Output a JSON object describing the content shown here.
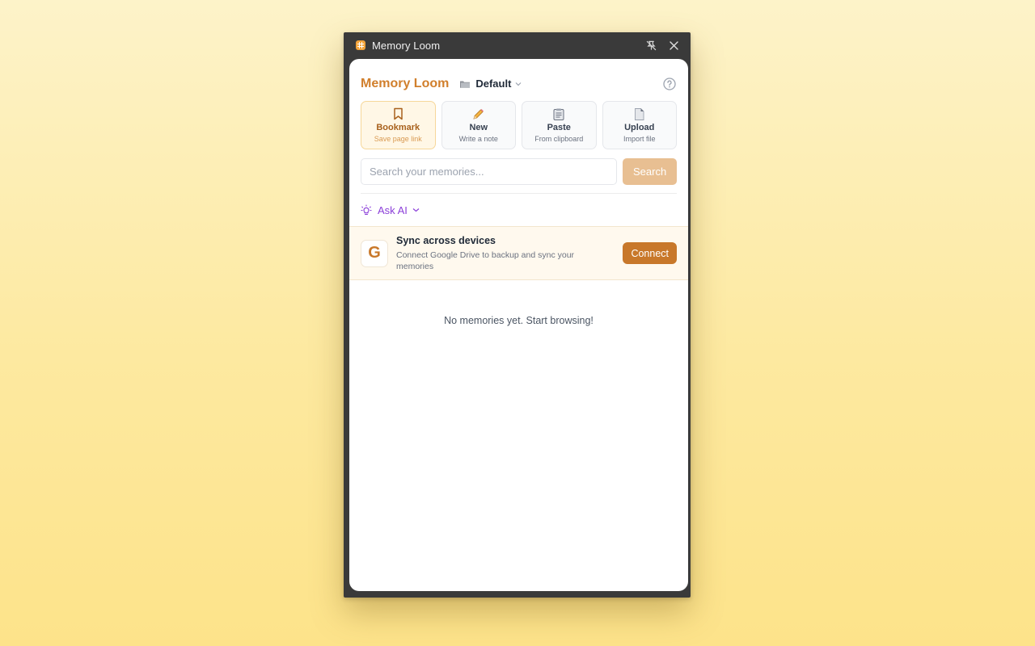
{
  "window": {
    "title": "Memory Loom"
  },
  "header": {
    "brand": "Memory Loom",
    "space": "Default"
  },
  "actions": [
    {
      "label": "Bookmark",
      "sub": "Save page link",
      "icon": "bookmark-icon",
      "active": true
    },
    {
      "label": "New",
      "sub": "Write a note",
      "icon": "pencil-icon",
      "active": false
    },
    {
      "label": "Paste",
      "sub": "From clipboard",
      "icon": "clipboard-icon",
      "active": false
    },
    {
      "label": "Upload",
      "sub": "Import file",
      "icon": "file-icon",
      "active": false
    }
  ],
  "search": {
    "placeholder": "Search your memories...",
    "value": "",
    "button": "Search"
  },
  "ask_ai": {
    "label": "Ask AI"
  },
  "sync": {
    "icon_letter": "G",
    "title": "Sync across devices",
    "subtitle": "Connect Google Drive to backup and sync your memories",
    "button": "Connect"
  },
  "empty_state": "No memories yet. Start browsing!",
  "colors": {
    "brand": "#d17f2c",
    "accent_purple": "#8b3fd9",
    "connect": "#c8782a",
    "search_button": "#e8bf92"
  }
}
